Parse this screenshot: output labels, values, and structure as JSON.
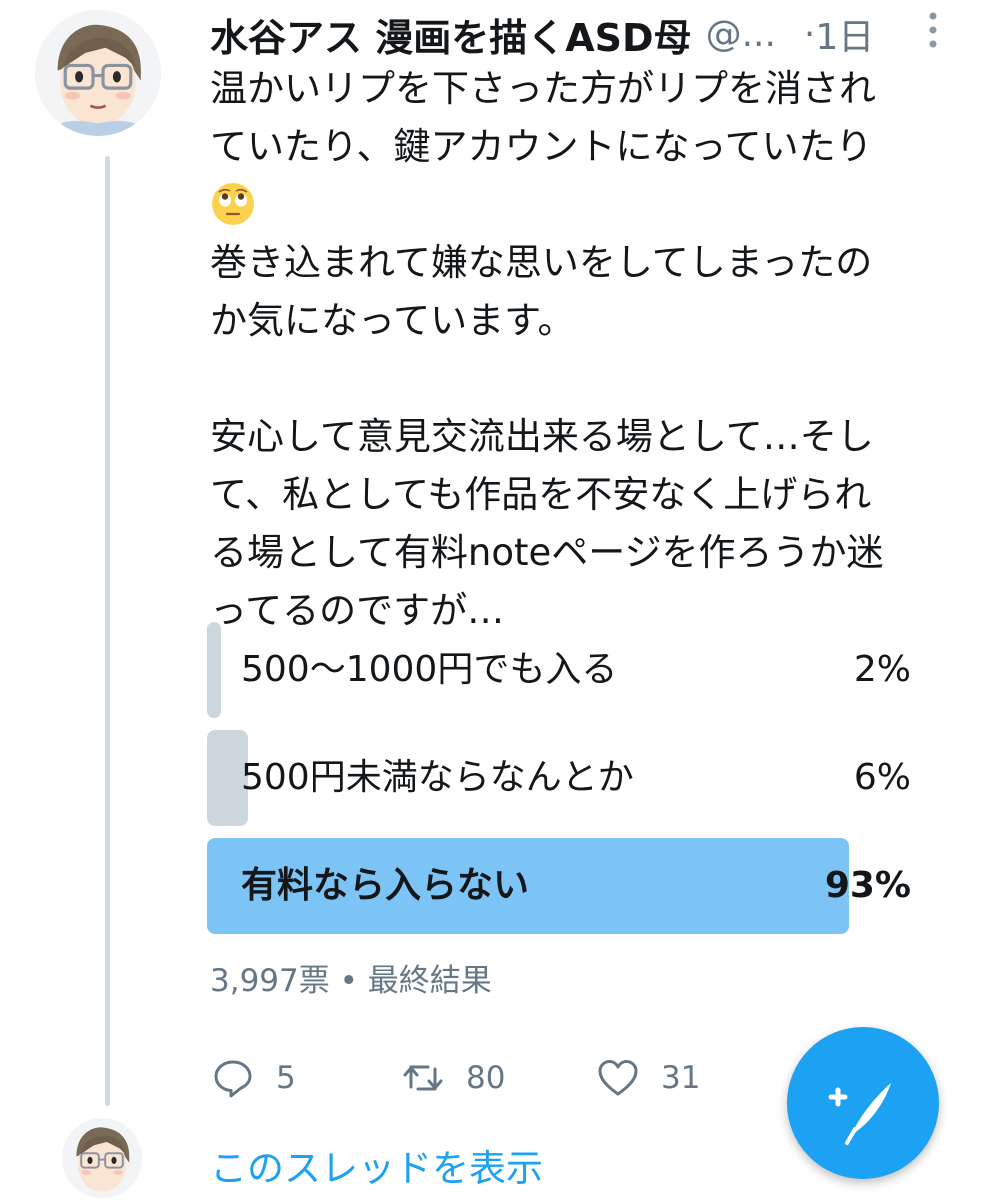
{
  "tweet": {
    "display_name": "水谷アス 漫画を描くASD母",
    "handle": "@...",
    "separator": "·",
    "timestamp": "1日",
    "text_lines": {
      "line1": "温かいリプを下さった方がリプを消され",
      "line2": "ていたり、鍵アカウントになっていたり",
      "line3": "巻き込まれて嫌な思いをしてしまったの",
      "line4": "か気になっています。",
      "line5": "安心して意見交流出来る場として…そし",
      "line6": "て、私としても作品を不安なく上げられ",
      "line7": "る場として有料noteページを作ろうか迷",
      "line8": "ってるのですが…"
    },
    "emoji_icon": "face-with-rolling-eyes-emoji"
  },
  "poll": {
    "options": [
      {
        "label": "500〜1000円でも入る",
        "percent_label": "2%",
        "fraction": 0.02
      },
      {
        "label": "500円未満ならなんとか",
        "percent_label": "6%",
        "fraction": 0.06
      },
      {
        "label": "有料なら入らない",
        "percent_label": "93%",
        "fraction": 0.93
      }
    ],
    "votes": "3,997票",
    "separator": "•",
    "status": "最終結果"
  },
  "actions": {
    "reply_count": "5",
    "retweet_count": "80",
    "like_count": "31"
  },
  "show_thread_label": "このスレッドを表示",
  "colors": {
    "accent": "#1da1f2",
    "poll_winner": "#7cc3f6",
    "poll_other": "#ccd6dd",
    "secondary_text": "#657786",
    "thread_line": "#cfd9de"
  },
  "icons": {
    "reply": "reply-icon",
    "retweet": "retweet-icon",
    "like": "heart-icon",
    "more": "more-vertical-icon",
    "compose": "compose-tweet-icon"
  }
}
